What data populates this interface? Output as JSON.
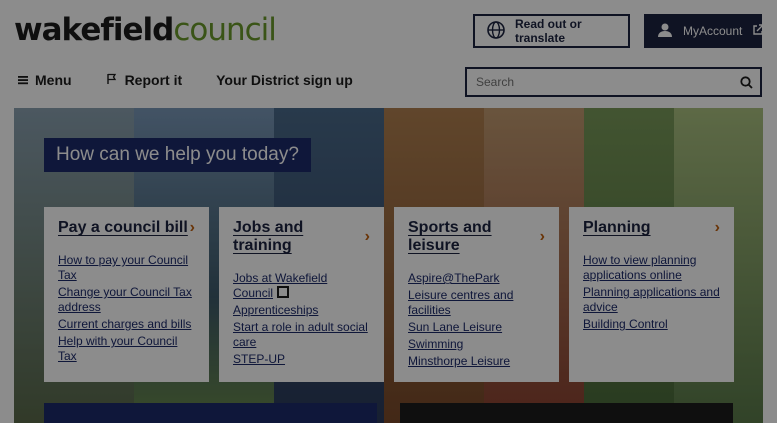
{
  "header": {
    "logo_part1": "wakefield",
    "logo_part2": "council",
    "translate_label": "Read out or translate",
    "account_label": "MyAccount"
  },
  "nav": {
    "menu_label": "Menu",
    "report_label": "Report it",
    "district_label": "Your District sign up"
  },
  "search": {
    "placeholder": "Search"
  },
  "hero": {
    "title": "How can we help you today?"
  },
  "cards": [
    {
      "title": "Pay a council bill",
      "links": [
        "How to pay your Council Tax",
        "Change your Council Tax address",
        "Current charges and bills",
        "Help with your Council Tax"
      ]
    },
    {
      "title": "Jobs and training",
      "links": [
        "Jobs at Wakefield Council",
        "Apprenticeships",
        "Start a role in adult social care",
        "STEP-UP"
      ]
    },
    {
      "title": "Sports and leisure",
      "links": [
        "Aspire@ThePark",
        "Leisure centres and facilities",
        "Sun Lane Leisure",
        "Swimming",
        "Minsthorpe Leisure"
      ]
    },
    {
      "title": "Planning",
      "links": [
        "How to view planning applications online",
        "Planning applications and advice",
        "Building Control"
      ]
    }
  ]
}
